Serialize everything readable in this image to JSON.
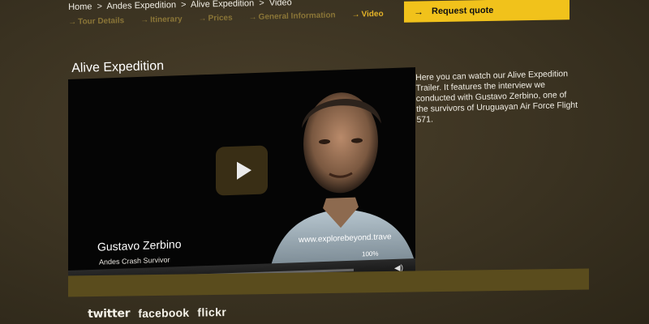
{
  "breadcrumb": {
    "items": [
      "Home",
      "Andes Expedition",
      "Alive Expedition",
      "Video"
    ],
    "separator": ">"
  },
  "subnav": {
    "items": [
      "Tour Details",
      "Itinerary",
      "Prices",
      "General Information",
      "Video"
    ],
    "active_index": 4,
    "arrow": "→"
  },
  "quote_button": {
    "label": "Request quote",
    "arrow": "→"
  },
  "page": {
    "title": "Alive Expedition",
    "description": "Here you can watch our Alive Expedition Trailer. It features the interview we conducted with Gustavo Zerbino, one of the survivors of Uruguayan Air Force Flight 571."
  },
  "video": {
    "person_name": "Gustavo Zerbino",
    "person_role": "Andes Crash Survivor",
    "watermark": "www.explorebeyond.trave",
    "volume": "100%"
  },
  "social": {
    "links": [
      "twitter",
      "facebook",
      "flickr"
    ]
  },
  "colors": {
    "background": "#3b3322",
    "accent": "#f1c21b",
    "link_muted": "#8a7537",
    "link_active": "#e5b428"
  }
}
